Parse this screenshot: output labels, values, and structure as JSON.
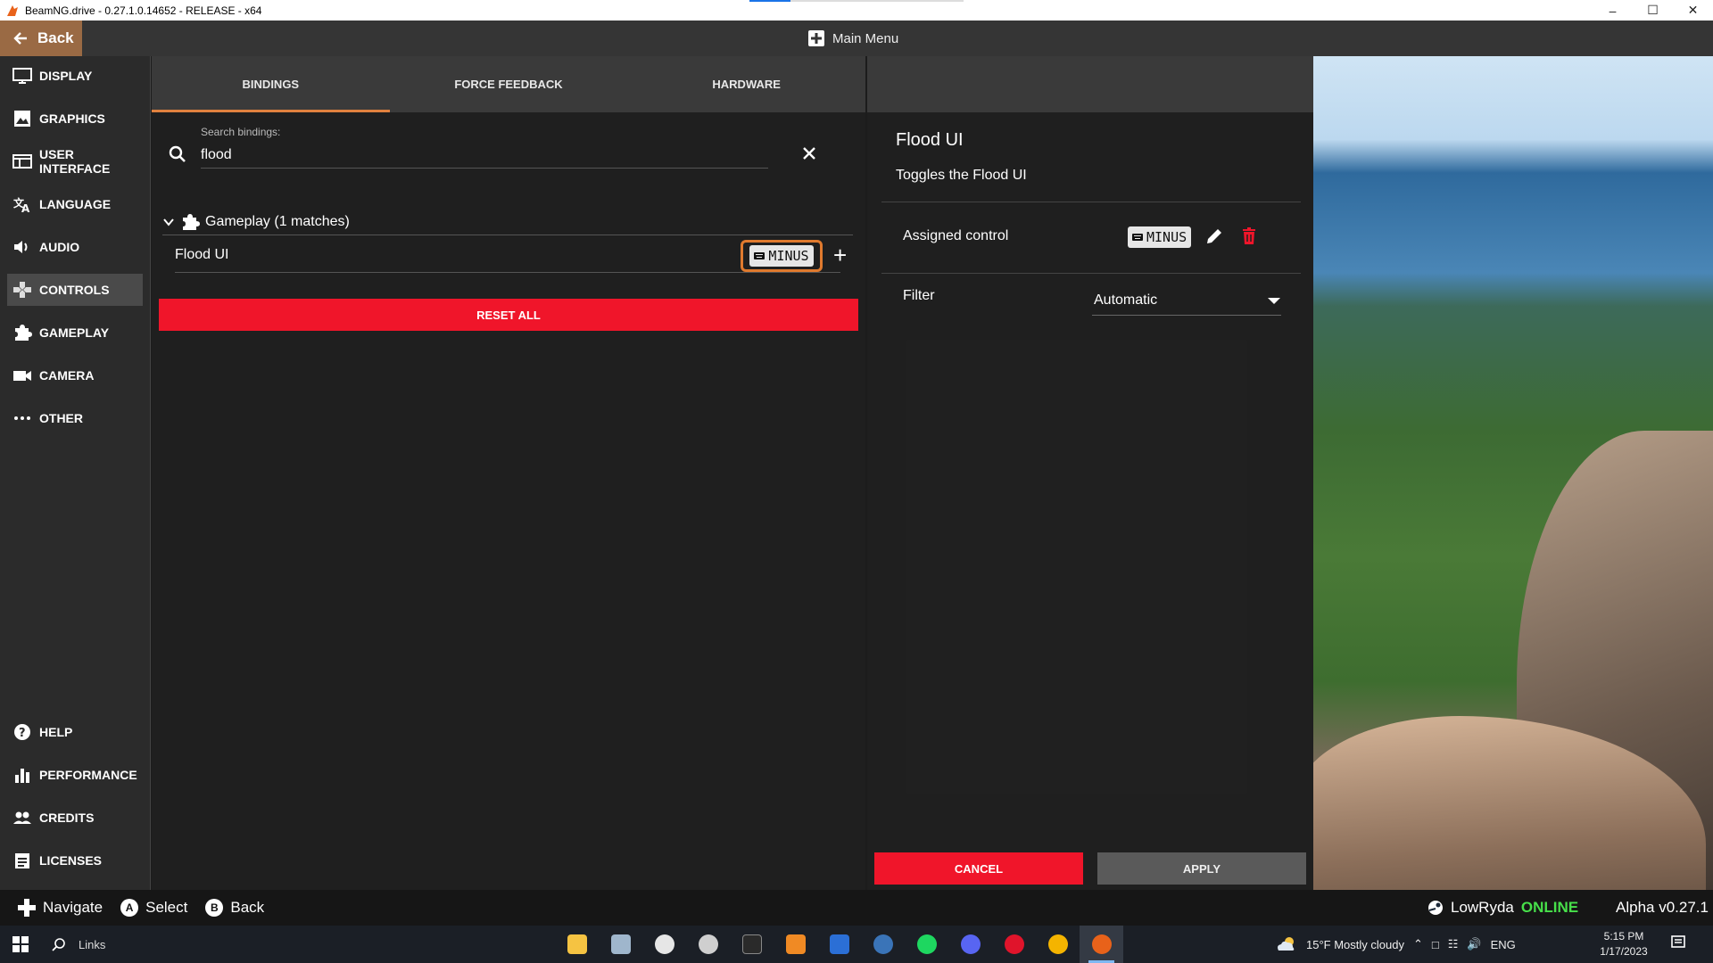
{
  "window": {
    "title": "BeamNG.drive - 0.27.1.0.14652 - RELEASE - x64",
    "load_progress": 0.19
  },
  "topbar": {
    "back_label": "Back",
    "title": "Main Menu"
  },
  "sidebar": {
    "items": [
      {
        "label": "DISPLAY",
        "icon": "monitor-icon",
        "active": false
      },
      {
        "label": "GRAPHICS",
        "icon": "image-icon",
        "active": false
      },
      {
        "label": "USER INTERFACE",
        "icon": "window-icon",
        "active": false
      },
      {
        "label": "LANGUAGE",
        "icon": "translate-icon",
        "active": false
      },
      {
        "label": "AUDIO",
        "icon": "speaker-icon",
        "active": false
      },
      {
        "label": "CONTROLS",
        "icon": "gamepad-icon",
        "active": true
      },
      {
        "label": "GAMEPLAY",
        "icon": "puzzle-icon",
        "active": false
      },
      {
        "label": "CAMERA",
        "icon": "camera-icon",
        "active": false
      },
      {
        "label": "OTHER",
        "icon": "more-icon",
        "active": false
      }
    ],
    "bottom_items": [
      {
        "label": "HELP",
        "icon": "help-icon"
      },
      {
        "label": "PERFORMANCE",
        "icon": "bar-chart-icon"
      },
      {
        "label": "CREDITS",
        "icon": "people-icon"
      },
      {
        "label": "LICENSES",
        "icon": "clipboard-icon"
      }
    ]
  },
  "bindings": {
    "tabs": [
      "BINDINGS",
      "FORCE FEEDBACK",
      "HARDWARE"
    ],
    "active_tab": "BINDINGS",
    "search": {
      "label": "Search bindings:",
      "value": "flood"
    },
    "group": {
      "label": "Gameplay (1 matches)"
    },
    "rows": [
      {
        "name": "Flood UI",
        "key": "MINUS"
      }
    ],
    "reset_label": "RESET ALL"
  },
  "detail": {
    "title": "Flood UI",
    "description": "Toggles the Flood UI",
    "assigned_label": "Assigned control",
    "assigned_key": "MINUS",
    "filter_label": "Filter",
    "filter_value": "Automatic",
    "cancel_label": "CANCEL",
    "apply_label": "APPLY"
  },
  "hints": {
    "navigate": "Navigate",
    "select_key": "A",
    "select": "Select",
    "back_key": "B",
    "back": "Back",
    "username": "LowRyda",
    "status": "ONLINE",
    "version": "Alpha v0.27.1"
  },
  "taskbar": {
    "search_text": "Links",
    "weather": "15°F  Mostly cloudy",
    "lang": "ENG",
    "time": "5:15 PM",
    "date": "1/17/2023"
  },
  "colors": {
    "accent_orange": "#e07a2e",
    "danger_red": "#f0152a",
    "online_green": "#47e04a"
  }
}
